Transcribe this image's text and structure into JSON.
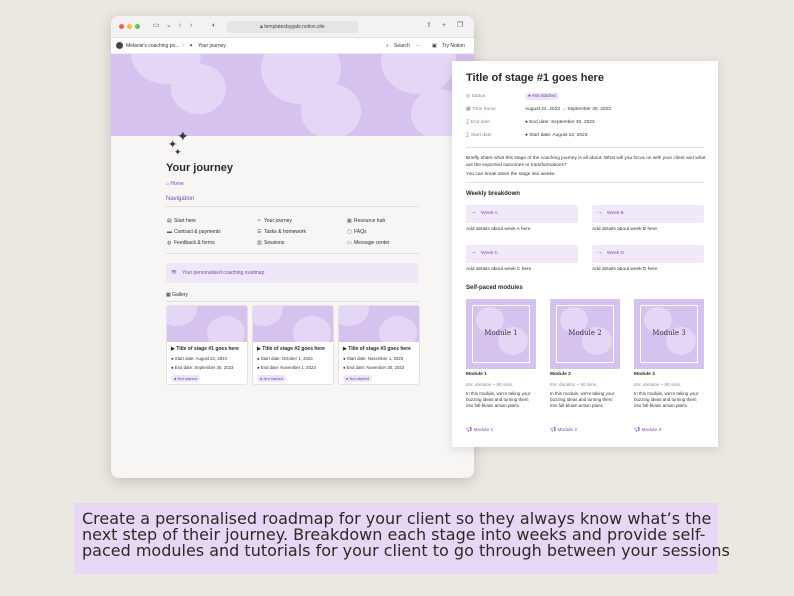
{
  "browser": {
    "url": "templatesbygabi.notion.site",
    "tab_breadcrumb": "Melanie's coaching po...",
    "breadcrumb_separator": "/",
    "breadcrumb_current": "Your journey",
    "search_label": "Search",
    "more_label": "···",
    "try_notion_label": "Try Notion"
  },
  "journey": {
    "title": "Your journey",
    "home_link": "Home",
    "nav_title": "Navigation",
    "nav_items": [
      {
        "label": "Start here",
        "icon": "book-icon"
      },
      {
        "label": "Your journey",
        "icon": "sparkle-icon"
      },
      {
        "label": "Resource hub",
        "icon": "box-icon"
      },
      {
        "label": "Contract & payments",
        "icon": "card-icon"
      },
      {
        "label": "Tasks & homework",
        "icon": "tasks-icon"
      },
      {
        "label": "FAQs",
        "icon": "faq-icon"
      },
      {
        "label": "Feedback & forms",
        "icon": "form-icon"
      },
      {
        "label": "Sessions",
        "icon": "sessions-icon"
      },
      {
        "label": "Message center",
        "icon": "message-icon"
      }
    ],
    "callout": "Your personalised coaching roadmap",
    "gallery_tab": "Gallery",
    "cards": [
      {
        "title": "Title of stage #1 goes here",
        "start": "Start date: August 22, 2023",
        "end": "End date: September 30, 2023",
        "status": "Not started"
      },
      {
        "title": "Title of stage #2 goes here",
        "start": "Start date: October 1, 2023",
        "end": "End date: November 1, 2023",
        "status": "Not started"
      },
      {
        "title": "Title of stage #3 goes here",
        "start": "Start date: November 1, 2023",
        "end": "End date: November 30, 2023",
        "status": "Not started"
      }
    ]
  },
  "stage": {
    "title": "Title of stage #1 goes here",
    "props": [
      {
        "label": "Status",
        "value": "Not started"
      },
      {
        "label": "Time frame",
        "value": "August 22, 2023 → September 30, 2023"
      },
      {
        "label": "End date",
        "value": "End date: September 30, 2023"
      },
      {
        "label": "Start date",
        "value": "Start date: August 22, 2023"
      }
    ],
    "intro": "Briefly share what this stage of the coaching journey is all about. What will you focus on with your client and what are the expected outcomes or transformations?",
    "intro2": "You can break down the stage into weeks.",
    "weekly_heading": "Weekly breakdown",
    "weeks": [
      {
        "label": "Week A",
        "desc": "Add details about week A here"
      },
      {
        "label": "Week B",
        "desc": "Add details about week B here"
      },
      {
        "label": "Week C",
        "desc": "Add details about week C here"
      },
      {
        "label": "Week D",
        "desc": "Add details about week D here"
      }
    ],
    "modules_heading": "Self-paced modules",
    "modules": [
      {
        "cover": "Module 1",
        "title": "Module 1",
        "duration": "Est. duration ~ 90 mins.",
        "desc": "In this module, we're taking your buzzing ideas and turning them into full-blown action plans.",
        "link": "Module 1"
      },
      {
        "cover": "Module 2",
        "title": "Module 2",
        "duration": "Est. duration ~ 90 mins.",
        "desc": "In this module, we're taking your buzzing ideas and turning them into full-blown action plans.",
        "link": "Module 2"
      },
      {
        "cover": "Module 3",
        "title": "Module 3",
        "duration": "Est. duration ~ 90 mins.",
        "desc": "In this module, we're taking your buzzing ideas and turning them into full-blown action plans.",
        "link": "Module 3"
      }
    ]
  },
  "caption": {
    "line1": "Create a personalised roadmap for your client so they always know what’s the",
    "line2": "next step of their journey. Breakdown each stage into weeks and provide self-",
    "line3": "paced modules and tutorials for your client to go through between your sessions"
  },
  "colors": {
    "accent": "#7a4bb5",
    "lilac": "#d5c2ef",
    "light_lilac": "#efe6f8",
    "background": "#ebe7e1"
  }
}
